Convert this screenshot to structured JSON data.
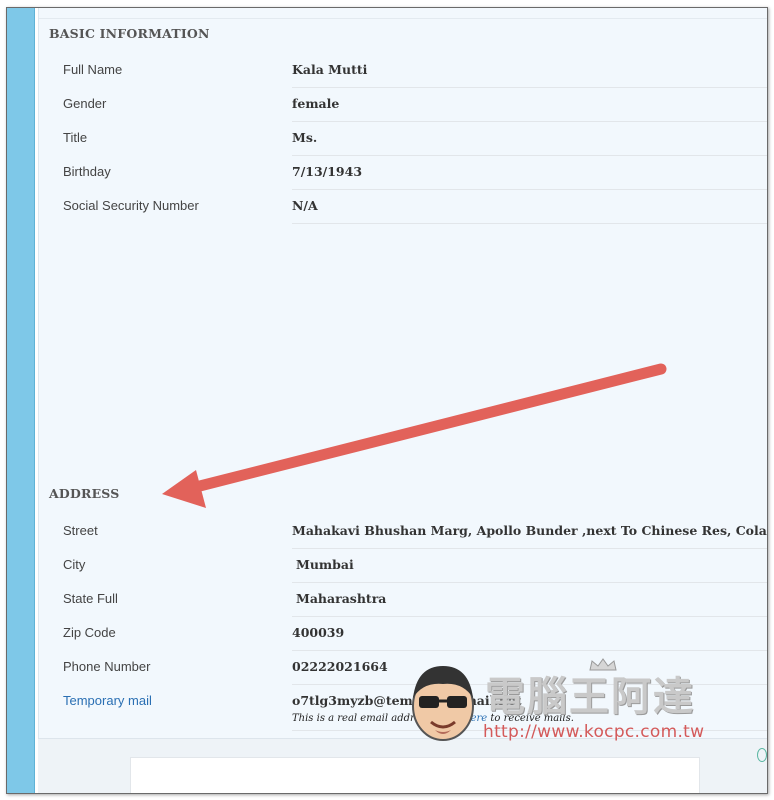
{
  "basic_information": {
    "title": "BASIC INFORMATION",
    "fields": [
      {
        "label": "Full Name",
        "value": "Kala  Mutti"
      },
      {
        "label": "Gender",
        "value": "female"
      },
      {
        "label": "Title",
        "value": "Ms."
      },
      {
        "label": "Birthday",
        "value": "7/13/1943"
      },
      {
        "label": "Social Security Number",
        "value": "N/A"
      }
    ]
  },
  "address": {
    "title": "ADDRESS",
    "fields": [
      {
        "label": "Street",
        "value": "Mahakavi Bhushan Marg, Apollo Bunder ,next To Chinese Res, Colaba"
      },
      {
        "label": "City",
        "value": "Mumbai"
      },
      {
        "label": "State Full",
        "value": "Maharashtra"
      },
      {
        "label": "Zip Code",
        "value": "400039"
      },
      {
        "label": "Phone Number",
        "value": "02222021664"
      },
      {
        "label": "Temporary mail",
        "value": "o7tlg3myzb@temporary-mail.net"
      }
    ],
    "temp_mail_note_prefix": "This is a real email address, click ",
    "temp_mail_note_link": "here",
    "temp_mail_note_suffix": " to receive mails."
  },
  "watermark": {
    "title": "電腦王阿達",
    "url": "http://www.kocpc.com.tw"
  },
  "colors": {
    "sidebar_stripe": "#7ec8e8",
    "panel_bg": "#f2f8fd",
    "arrow": "#e2625a",
    "link": "#2a6fb3"
  }
}
